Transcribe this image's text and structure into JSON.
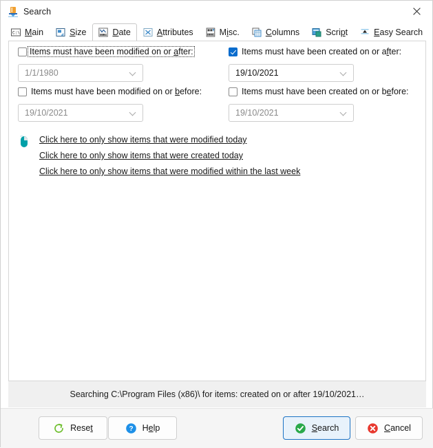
{
  "window": {
    "title": "Search",
    "icon": "search-tool-icon",
    "close_icon": "close-icon"
  },
  "tabs": [
    {
      "label": "Main",
      "icon": "console-icon",
      "active": false,
      "accel": "M"
    },
    {
      "label": "Size",
      "icon": "size-icon",
      "active": false,
      "accel": "S"
    },
    {
      "label": "Date",
      "icon": "date-chart-icon",
      "active": true,
      "accel": "D"
    },
    {
      "label": "Attributes",
      "icon": "attributes-icon",
      "active": false,
      "accel": "A"
    },
    {
      "label": "Misc.",
      "icon": "misc-icon",
      "active": false,
      "accel": "i"
    },
    {
      "label": "Columns",
      "icon": "columns-icon",
      "active": false,
      "accel": "C"
    },
    {
      "label": "Script",
      "icon": "script-icon",
      "active": false,
      "accel": "p"
    },
    {
      "label": "Easy Search",
      "icon": "easy-search-icon",
      "active": false,
      "accel": "E"
    }
  ],
  "date_filters": {
    "modified_after": {
      "label_pre": "Items must have been modified on or ",
      "label_accel": "a",
      "label_post": "fter:",
      "checked": false,
      "focused": true,
      "value": "1/1/1980",
      "enabled": false
    },
    "created_after": {
      "label_pre": "Items must have been created on or a",
      "label_accel": "f",
      "label_post": "ter:",
      "checked": true,
      "focused": false,
      "value": "19/10/2021",
      "enabled": true
    },
    "modified_before": {
      "label_pre": "Items must have been modified on or ",
      "label_accel": "b",
      "label_post": "efore:",
      "checked": false,
      "focused": false,
      "value": "19/10/2021",
      "enabled": false
    },
    "created_before": {
      "label_pre": "Items must have been created on or b",
      "label_accel": "e",
      "label_post": "fore:",
      "checked": false,
      "focused": false,
      "value": "19/10/2021",
      "enabled": false
    }
  },
  "quick_links": {
    "icon": "mouse-icon",
    "items": [
      "Click here to only show items that were modified today",
      "Click here to only show items that were created today",
      "Click here to only show items that were modified within the last week"
    ]
  },
  "status": {
    "text": "Searching C:\\Program Files (x86)\\ for items: created on or after 19/10/2021…"
  },
  "buttons": {
    "reset": {
      "pre": "Rese",
      "accel": "t",
      "post": "",
      "icon": "refresh-icon",
      "default": false
    },
    "help": {
      "pre": "H",
      "accel": "e",
      "post": "lp",
      "icon": "help-icon",
      "default": false
    },
    "search": {
      "pre": "",
      "accel": "S",
      "post": "earch",
      "icon": "check-circle-icon",
      "default": true
    },
    "cancel": {
      "pre": "",
      "accel": "C",
      "post": "ancel",
      "icon": "cancel-circle-icon",
      "default": false
    }
  },
  "colors": {
    "accent": "#0a6ccd",
    "default_button_border": "#1a72c4",
    "success": "#2aa94b",
    "danger": "#e8382e",
    "help_blue": "#1e90e8",
    "reset_green": "#6fbf2f",
    "mouse_teal": "#00a0a8"
  }
}
